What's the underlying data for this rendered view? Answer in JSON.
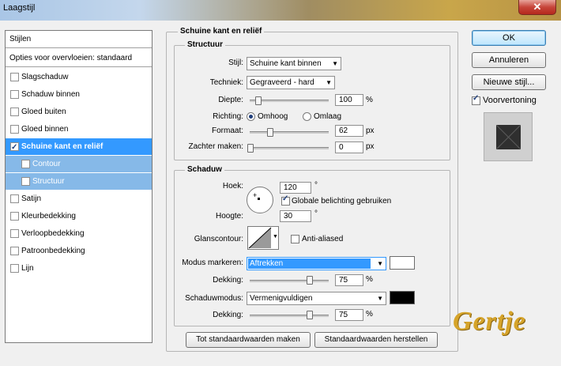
{
  "window": {
    "title": "Laagstijl",
    "close_glyph": "✕"
  },
  "styles_list": {
    "header": "Stijlen",
    "blending": "Opties voor overvloeien: standaard",
    "items": [
      {
        "label": "Slagschaduw",
        "checked": false
      },
      {
        "label": "Schaduw binnen",
        "checked": false
      },
      {
        "label": "Gloed buiten",
        "checked": false
      },
      {
        "label": "Gloed binnen",
        "checked": false
      },
      {
        "label": "Schuine kant en reliëf",
        "checked": true
      },
      {
        "label": "Contour",
        "checked": false
      },
      {
        "label": "Structuur",
        "checked": false
      },
      {
        "label": "Satijn",
        "checked": false
      },
      {
        "label": "Kleurbedekking",
        "checked": false
      },
      {
        "label": "Verloopbedekking",
        "checked": false
      },
      {
        "label": "Patroonbedekking",
        "checked": false
      },
      {
        "label": "Lijn",
        "checked": false
      }
    ]
  },
  "panel": {
    "title": "Schuine kant en reliëf",
    "structure": {
      "title": "Structuur",
      "style_label": "Stijl:",
      "style_value": "Schuine kant binnen",
      "technique_label": "Techniek:",
      "technique_value": "Gegraveerd - hard",
      "depth_label": "Diepte:",
      "depth_value": "100",
      "depth_unit": "%",
      "direction_label": "Richting:",
      "direction_up": "Omhoog",
      "direction_down": "Omlaag",
      "size_label": "Formaat:",
      "size_value": "62",
      "size_unit": "px",
      "soften_label": "Zachter maken:",
      "soften_value": "0",
      "soften_unit": "px"
    },
    "shading": {
      "title": "Schaduw",
      "angle_label": "Hoek:",
      "angle_value": "120",
      "degree": "°",
      "global_light_label": "Globale belichting gebruiken",
      "altitude_label": "Hoogte:",
      "altitude_value": "30",
      "gloss_label": "Glanscontour:",
      "antialiased_label": "Anti-aliased",
      "highlight_label": "Modus markeren:",
      "highlight_value": "Aftrekken",
      "highlight_opacity_label": "Dekking:",
      "highlight_opacity_value": "75",
      "highlight_opacity_unit": "%",
      "shadow_label": "Schaduwmodus:",
      "shadow_value": "Vermenigvuldigen",
      "shadow_opacity_label": "Dekking:",
      "shadow_opacity_value": "75",
      "shadow_opacity_unit": "%"
    },
    "make_default": "Tot standaardwaarden maken",
    "reset_default": "Standaardwaarden herstellen"
  },
  "buttons": {
    "ok": "OK",
    "cancel": "Annuleren",
    "new_style": "Nieuwe stijl...",
    "preview_label": "Voorvertoning"
  },
  "sliders": {
    "depth": 0.1,
    "size": 0.25,
    "soften": 0.0,
    "highlight_opacity": 0.75,
    "shadow_opacity": 0.75
  },
  "colors": {
    "highlight": "#ffffff",
    "shadow": "#000000",
    "selection": "#3399ff"
  },
  "watermark": "Gertje"
}
